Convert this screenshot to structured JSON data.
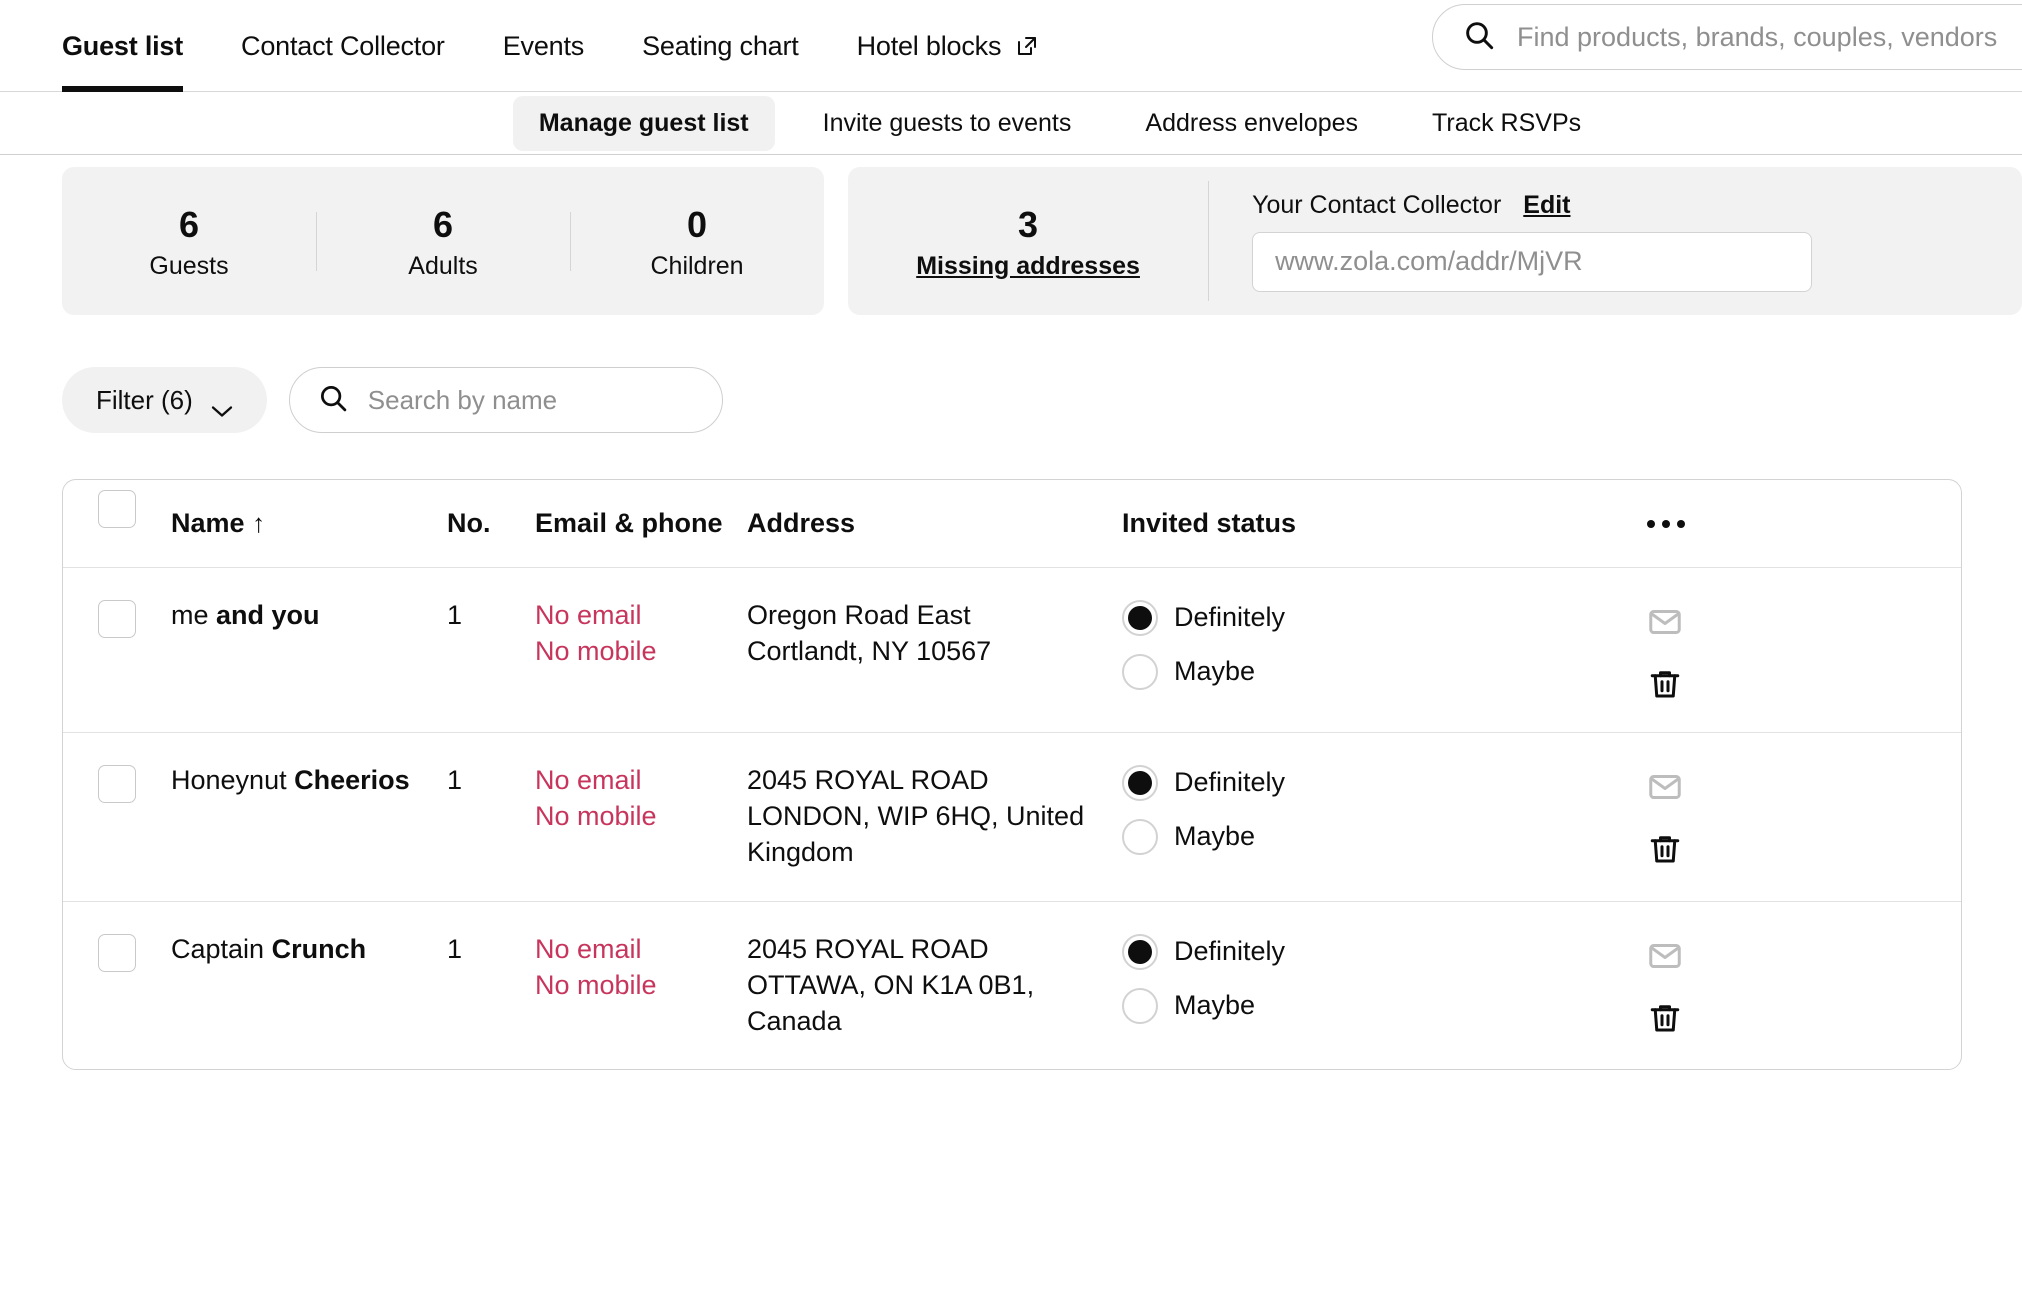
{
  "topnav": {
    "tabs": [
      {
        "label": "Guest list",
        "active": true
      },
      {
        "label": "Contact Collector",
        "active": false
      },
      {
        "label": "Events",
        "active": false
      },
      {
        "label": "Seating chart",
        "active": false
      },
      {
        "label": "Hotel blocks",
        "active": false,
        "icon": "external-link-icon"
      }
    ],
    "search": {
      "placeholder": "Find products, brands, couples, vendors",
      "value": "",
      "icon": "search-icon"
    }
  },
  "subnav": {
    "items": [
      {
        "label": "Manage guest list",
        "active": true
      },
      {
        "label": "Invite guests to events",
        "active": false
      },
      {
        "label": "Address envelopes",
        "active": false
      },
      {
        "label": "Track RSVPs",
        "active": false
      }
    ]
  },
  "stats": {
    "guests": {
      "value": "6",
      "label": "Guests"
    },
    "adults": {
      "value": "6",
      "label": "Adults"
    },
    "children": {
      "value": "0",
      "label": "Children"
    },
    "missing_addresses": {
      "value": "3",
      "label": "Missing addresses"
    },
    "collector": {
      "title": "Your Contact Collector",
      "edit_label": "Edit",
      "url": "www.zola.com/addr/MjVR"
    }
  },
  "toolbar": {
    "filter_label": "Filter (6)",
    "filter_icon": "chevron-down-icon",
    "search": {
      "placeholder": "Search by name",
      "value": "",
      "icon": "search-icon"
    }
  },
  "table": {
    "headers": {
      "name": "Name",
      "sort_indicator": "↑",
      "no": "No.",
      "email_phone": "Email & phone",
      "address": "Address",
      "invited_status": "Invited status",
      "more_icon": "more-options-icon"
    },
    "status_options": [
      "Definitely",
      "Maybe"
    ],
    "rows": [
      {
        "first_name": "me",
        "last_name": "and you",
        "no": "1",
        "email": "No email",
        "mobile": "No mobile",
        "address_lines": [
          "Oregon Road East",
          "Cortlandt, NY 10567"
        ],
        "status": "Definitely"
      },
      {
        "first_name": "Honeynut",
        "last_name": "Cheerios",
        "no": "1",
        "email": "No email",
        "mobile": "No mobile",
        "address_lines": [
          "2045 ROYAL ROAD",
          "LONDON, WIP 6HQ, United",
          "Kingdom"
        ],
        "status": "Definitely"
      },
      {
        "first_name": "Captain",
        "last_name": "Crunch",
        "no": "1",
        "email": "No email",
        "mobile": "No mobile",
        "address_lines": [
          "2045 ROYAL ROAD",
          "OTTAWA, ON K1A 0B1,",
          "Canada"
        ],
        "status": "Definitely"
      }
    ]
  },
  "colors": {
    "accent_red": "#c8355c",
    "text": "#0e0e0e",
    "card_bg": "#f2f2f2"
  }
}
